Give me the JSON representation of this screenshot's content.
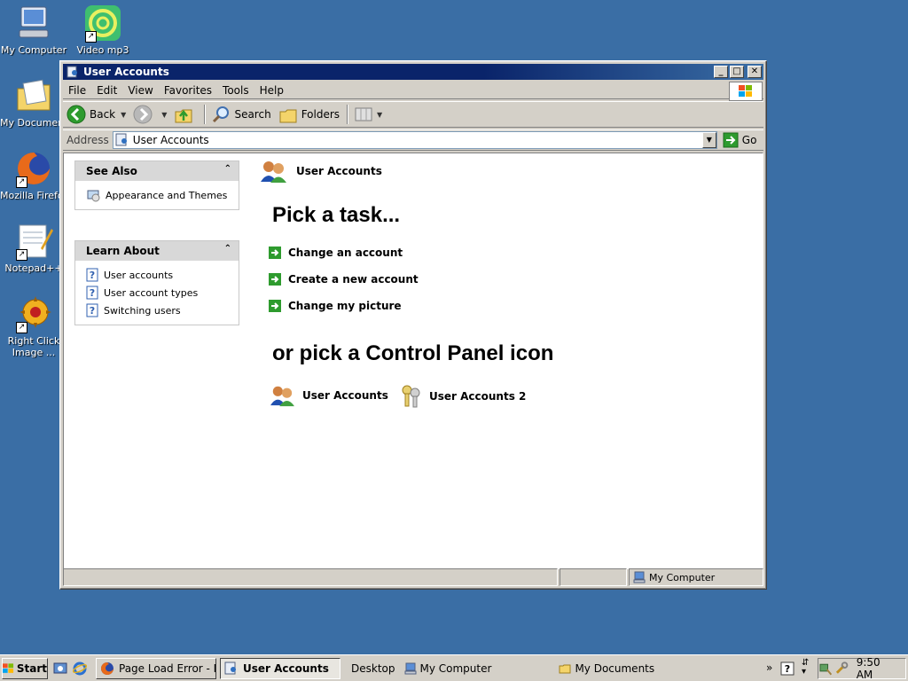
{
  "desktop": {
    "icons": [
      {
        "label": "My Computer",
        "icon": "my-computer-icon"
      },
      {
        "label": "Video mp3",
        "icon": "video-mp3-icon"
      },
      {
        "label": "My Documents",
        "icon": "my-documents-icon"
      },
      {
        "label": "Mozilla Firefox",
        "icon": "firefox-icon"
      },
      {
        "label": "Notepad++",
        "icon": "notepad-icon"
      },
      {
        "label": "Right Click Image ...",
        "icon": "right-click-image-icon"
      }
    ]
  },
  "window": {
    "title": "User Accounts",
    "menu": [
      "File",
      "Edit",
      "View",
      "Favorites",
      "Tools",
      "Help"
    ],
    "toolbar": {
      "back": "Back",
      "search": "Search",
      "folders": "Folders"
    },
    "address": {
      "label": "Address",
      "value": "User Accounts",
      "go": "Go"
    },
    "see_also": {
      "title": "See Also",
      "items": [
        "Appearance and Themes"
      ]
    },
    "learn_about": {
      "title": "Learn About",
      "items": [
        "User accounts",
        "User account types",
        "Switching users"
      ]
    },
    "category_title": "User Accounts",
    "pick_task_heading": "Pick a task...",
    "tasks": [
      "Change an account",
      "Create a new account",
      "Change my picture"
    ],
    "pick_icon_heading": "or pick a Control Panel icon",
    "cp_icons": [
      "User Accounts",
      "User Accounts 2"
    ],
    "status": {
      "zone": "My Computer"
    }
  },
  "taskbar": {
    "start": "Start",
    "buttons": [
      "Page Load Error - M...",
      "User Accounts"
    ],
    "links": [
      "Desktop",
      "My Computer",
      "My Documents"
    ],
    "clock": "9:50 AM"
  },
  "colors": {
    "desktop": "#3a6ea5",
    "titlebar": "#0a246a",
    "arrow_green": "#2e9b2e"
  }
}
